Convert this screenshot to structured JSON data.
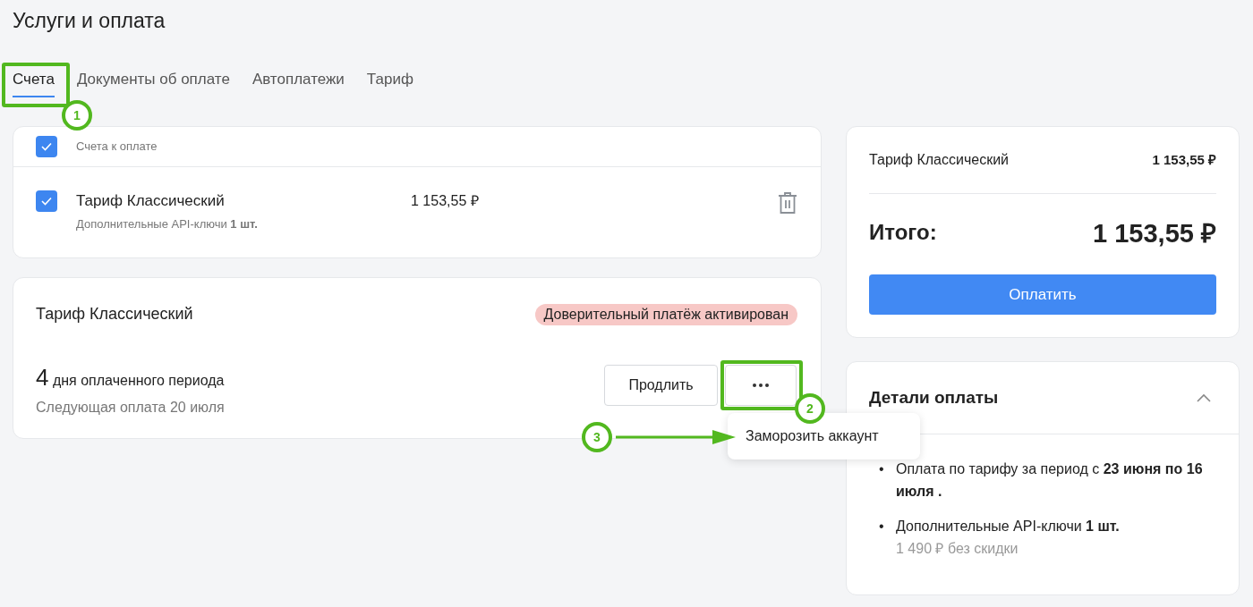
{
  "page_title": "Услуги и оплата",
  "tabs": [
    {
      "label": "Счета",
      "selected": true
    },
    {
      "label": "Документы об оплате",
      "selected": false
    },
    {
      "label": "Автоплатежи",
      "selected": false
    },
    {
      "label": "Тариф",
      "selected": false
    }
  ],
  "invoices": {
    "select_all_checked": true,
    "header": "Счета к оплате",
    "rows": [
      {
        "checked": true,
        "title": "Тариф Классический",
        "subtitle": "Дополнительные API-ключи **1 шт.**",
        "amount": "1 153,55 ₽"
      }
    ]
  },
  "plan": {
    "title": "Тариф Классический",
    "badge": "Доверительный платёж активирован",
    "days": "4",
    "days_label": "дня оплаченного периода",
    "next_payment": "Следующая оплата 20 июля",
    "extend_button": "Продлить"
  },
  "menu": {
    "items": [
      "Заморозить аккаунт"
    ]
  },
  "summary": {
    "line_label": "Тариф Классический",
    "line_amount": "1 153,55 ₽",
    "total_label": "Итого:",
    "total_amount": "1 153,55 ₽",
    "pay_button": "Оплатить"
  },
  "details": {
    "title": "Детали оплаты",
    "expanded": true,
    "items": [
      {
        "marker": "•",
        "text": "Оплата по тарифу за период с **23 июня по 16 июля .**"
      },
      {
        "marker": "•",
        "text": "Дополнительные API-ключи **1 шт.**",
        "note": "1 490 ₽ без скидки"
      }
    ]
  },
  "annotations": [
    {
      "number": "1"
    },
    {
      "number": "2"
    },
    {
      "number": "3"
    }
  ]
}
